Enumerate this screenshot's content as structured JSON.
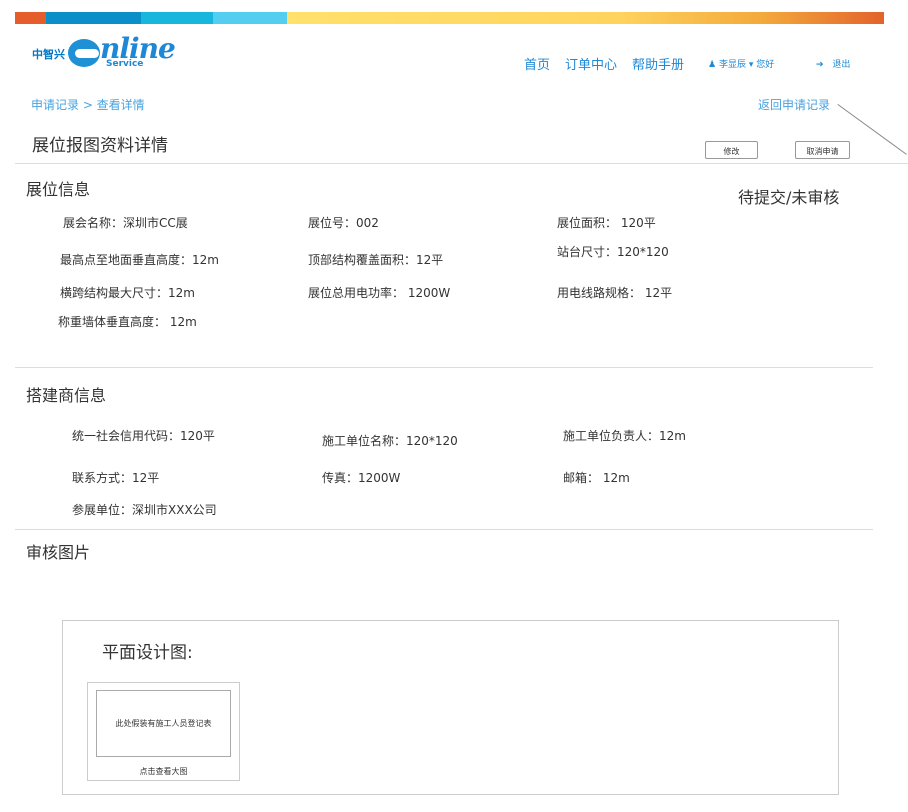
{
  "brand": {
    "colors": [
      "#e55d2b",
      "#0b8fc9",
      "#17b6dc",
      "#53cdf0",
      "#ffd966",
      "#f0ae3c",
      "#e2632c"
    ],
    "logo_cn": "中智兴",
    "logo_online": "nline",
    "logo_service": "Service"
  },
  "nav": {
    "home": "首页",
    "orders": "订单中心",
    "help": "帮助手册",
    "user": "李显辰",
    "greeting": "您好",
    "logout": "退出"
  },
  "breadcrumb": "申请记录 > 查看详情",
  "back_link": "返回申请记录",
  "page_title": "展位报图资料详情",
  "buttons": {
    "edit": "修改",
    "cancel": "取消申请"
  },
  "status": "待提交/未审核",
  "booth_section": {
    "title": "展位信息",
    "fields": [
      "展会名称：深圳市CC展",
      "展位号：002",
      "展位面积：  120平",
      "最高点至地面垂直高度：12m",
      "顶部结构覆盖面积：12平",
      "站台尺寸：120*120",
      "横跨结构最大尺寸：12m",
      "展位总用电功率：  1200W",
      "用电线路规格：  12平",
      "称重墙体垂直高度：  12m"
    ]
  },
  "builder_section": {
    "title": "搭建商信息",
    "fields": [
      "统一社会信用代码：120平",
      "施工单位名称：120*120",
      "施工单位负责人：12m",
      "联系方式：12平",
      "传真：1200W",
      "邮箱：  12m",
      "参展单位：深圳市XXX公司"
    ]
  },
  "review_section": {
    "title": "审核图片",
    "panel_title": "平面设计图:",
    "thumb_text": "此处假装有施工人员登记表",
    "thumb_caption": "点击查看大图"
  }
}
